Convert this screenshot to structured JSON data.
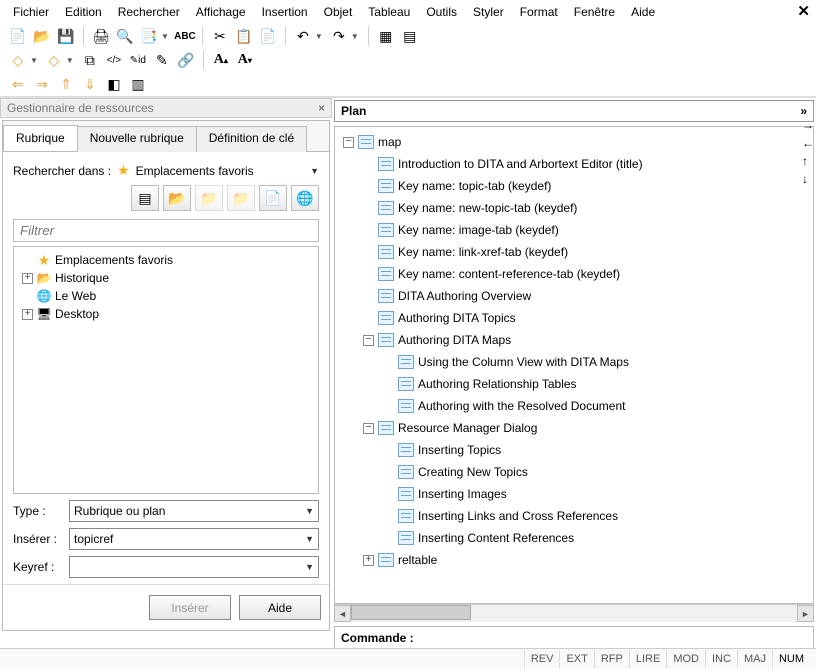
{
  "menubar": [
    "Fichier",
    "Edition",
    "Rechercher",
    "Affichage",
    "Insertion",
    "Objet",
    "Tableau",
    "Outils",
    "Styler",
    "Format",
    "Fenêtre",
    "Aide"
  ],
  "resource_manager": {
    "title": "Gestionnaire de ressources",
    "tabs": {
      "topic": "Rubrique",
      "new_topic": "Nouvelle rubrique",
      "keydef": "Définition de clé"
    },
    "look_in_label": "Rechercher dans :",
    "look_in_value": "Emplacements favoris",
    "filter_placeholder": "Filtrer",
    "tree": [
      {
        "label": "Emplacements favoris",
        "icon": "star"
      },
      {
        "label": "Historique",
        "icon": "folder",
        "expandable": true
      },
      {
        "label": "Le Web",
        "icon": "globe"
      },
      {
        "label": "Desktop",
        "icon": "desktop",
        "expandable": true
      }
    ],
    "labels": {
      "type": "Type :",
      "insert": "Insérer :",
      "keyref": "Keyref :"
    },
    "type_value": "Rubrique ou plan",
    "insert_value": "topicref",
    "keyref_value": "",
    "buttons": {
      "insert": "Insérer",
      "help": "Aide"
    }
  },
  "plan": {
    "title": "Plan",
    "nodes": [
      {
        "depth": 0,
        "label": "map",
        "expand": "minus"
      },
      {
        "depth": 1,
        "label": "Introduction to DITA and Arbortext Editor (title)"
      },
      {
        "depth": 1,
        "label": "Key name: topic-tab (keydef)"
      },
      {
        "depth": 1,
        "label": "Key name: new-topic-tab (keydef)"
      },
      {
        "depth": 1,
        "label": "Key name: image-tab (keydef)"
      },
      {
        "depth": 1,
        "label": "Key name: link-xref-tab (keydef)"
      },
      {
        "depth": 1,
        "label": "Key name: content-reference-tab (keydef)"
      },
      {
        "depth": 1,
        "label": "DITA Authoring Overview"
      },
      {
        "depth": 1,
        "label": "Authoring DITA Topics"
      },
      {
        "depth": 1,
        "label": "Authoring DITA Maps",
        "expand": "minus"
      },
      {
        "depth": 2,
        "label": "Using the Column View with DITA Maps"
      },
      {
        "depth": 2,
        "label": "Authoring Relationship Tables"
      },
      {
        "depth": 2,
        "label": "Authoring with the Resolved Document"
      },
      {
        "depth": 1,
        "label": "Resource Manager Dialog",
        "expand": "minus"
      },
      {
        "depth": 2,
        "label": "Inserting Topics"
      },
      {
        "depth": 2,
        "label": "Creating New Topics"
      },
      {
        "depth": 2,
        "label": "Inserting Images"
      },
      {
        "depth": 2,
        "label": "Inserting Links and Cross References"
      },
      {
        "depth": 2,
        "label": "Inserting Content References"
      },
      {
        "depth": 1,
        "label": "reltable",
        "expand": "plus"
      }
    ]
  },
  "commande_label": "Commande :",
  "status": [
    "REV",
    "EXT",
    "RFP",
    "LIRE",
    "MOD",
    "INC",
    "MAJ",
    "NUM"
  ],
  "status_active": "NUM"
}
